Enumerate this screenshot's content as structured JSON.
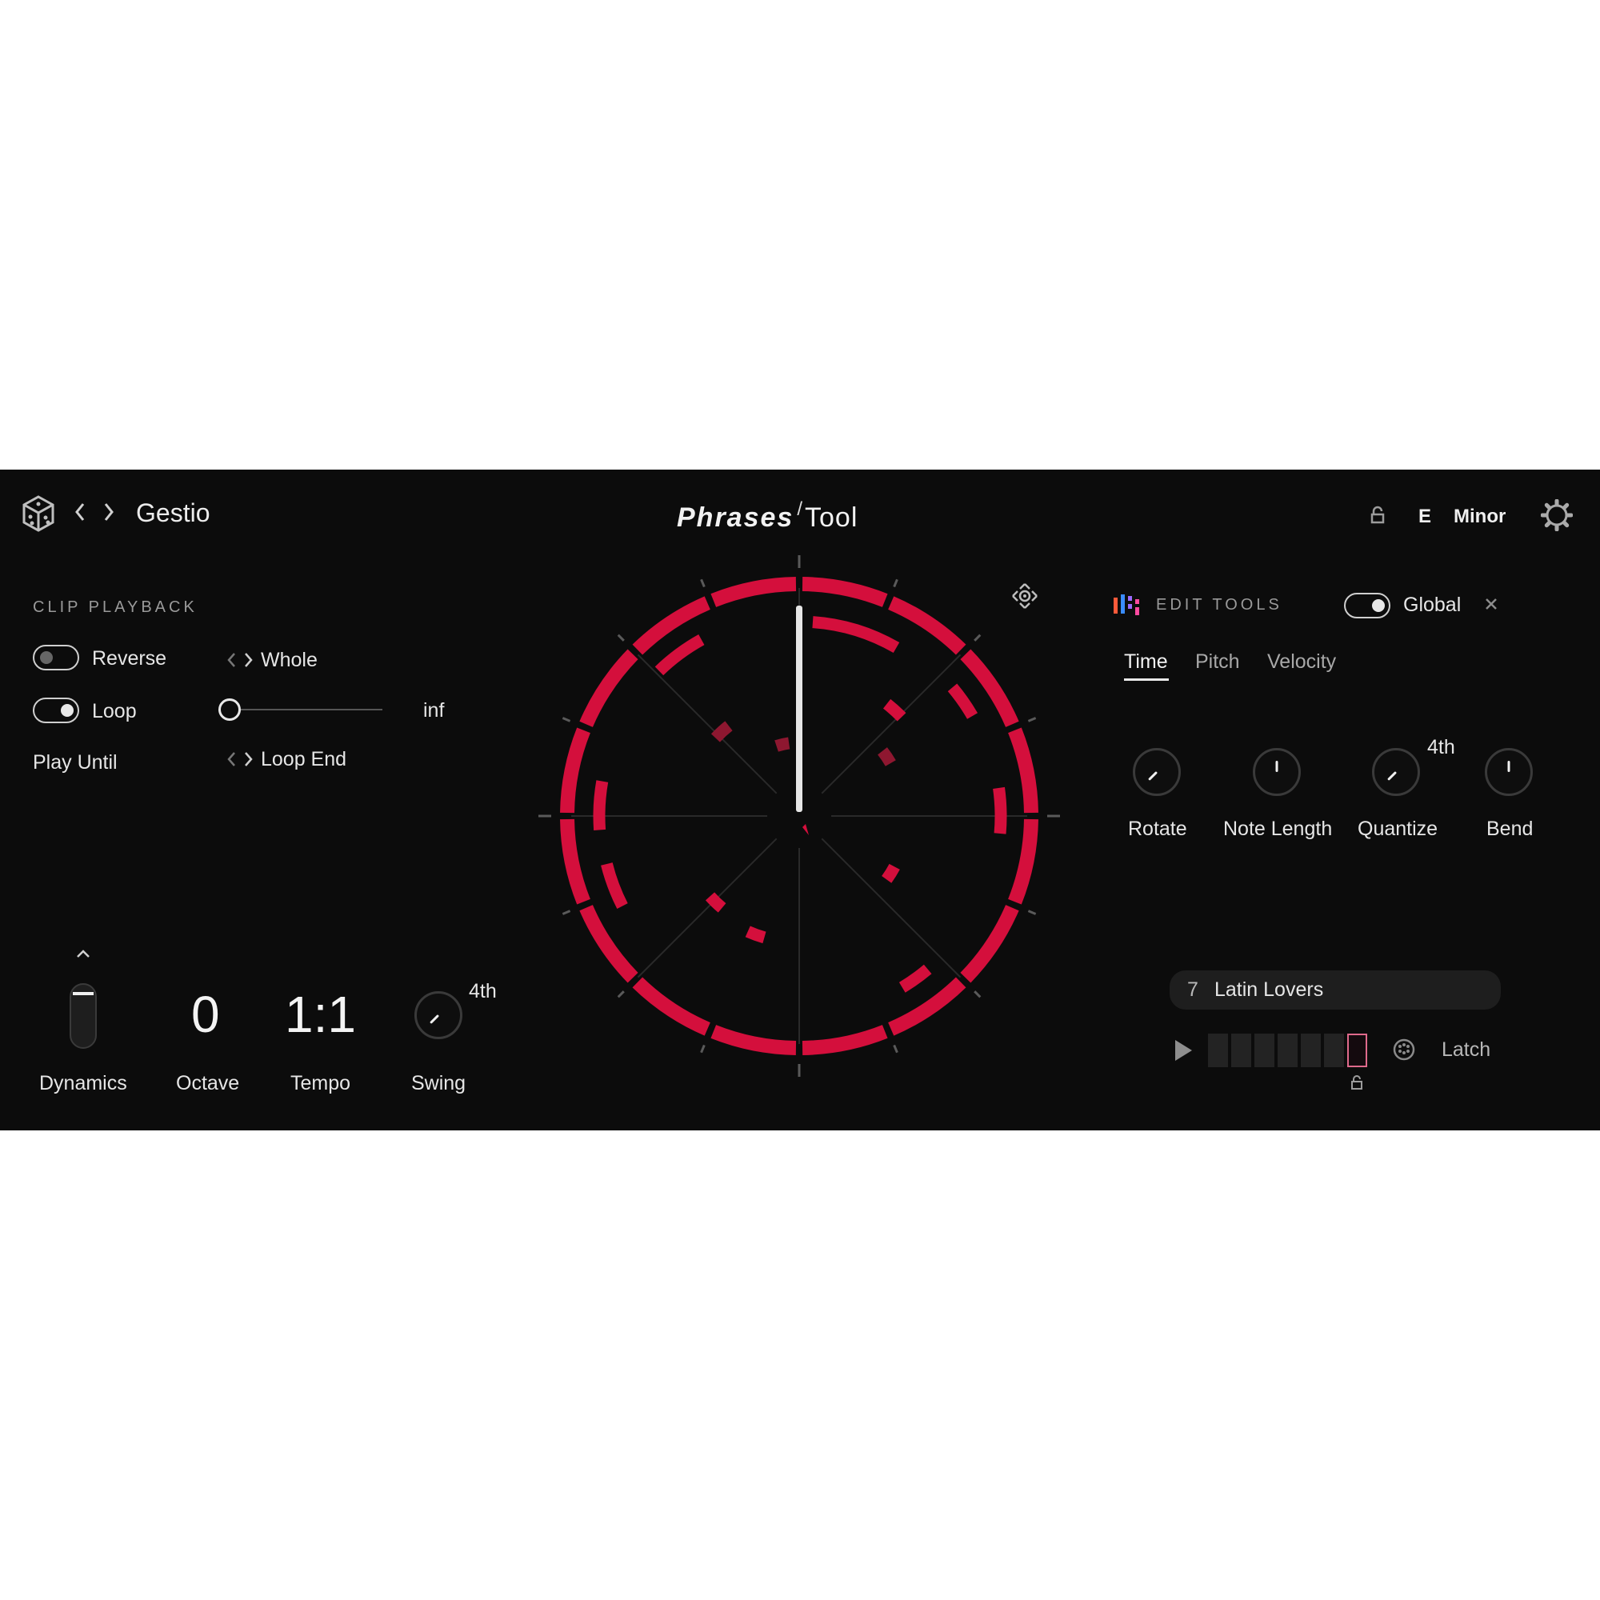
{
  "header": {
    "app_icon": "dice-icon",
    "prev_icon": "chevron-left-icon",
    "next_icon": "chevron-right-icon",
    "title": "Gestio",
    "brand_main": "Phrases",
    "brand_slash": "/",
    "brand_sub": "Tool",
    "lock_icon": "lock-icon",
    "key_root": "E",
    "key_scale": "Minor",
    "settings_icon": "gear-icon"
  },
  "clip_playback": {
    "section_label": "CLIP PLAYBACK",
    "reverse_label": "Reverse",
    "reverse_on": false,
    "loop_label": "Loop",
    "loop_on": true,
    "length_value": "Whole",
    "loop_slider_value": "inf",
    "play_until_label": "Play Until",
    "play_until_value": "Loop End"
  },
  "bottom_controls": {
    "dynamics_label": "Dynamics",
    "octave_value": "0",
    "octave_label": "Octave",
    "tempo_value": "1:1",
    "tempo_label": "Tempo",
    "swing_value": "4th",
    "swing_label": "Swing"
  },
  "edit_tools": {
    "section_label": "EDIT TOOLS",
    "global_label": "Global",
    "global_on": true,
    "close_icon": "close-icon",
    "tabs": [
      {
        "label": "Time",
        "active": true
      },
      {
        "label": "Pitch",
        "active": false
      },
      {
        "label": "Velocity",
        "active": false
      }
    ],
    "knobs": [
      {
        "label": "Rotate",
        "value": ""
      },
      {
        "label": "Note Length",
        "value": ""
      },
      {
        "label": "Quantize",
        "value": "4th"
      },
      {
        "label": "Bend",
        "value": ""
      }
    ]
  },
  "preset": {
    "number": "7",
    "name": "Latin Lovers",
    "play_icon": "play-icon",
    "step_count": 7,
    "current_step": 7,
    "pattern_icon": "pattern-icon",
    "latch_label": "Latch"
  },
  "colors": {
    "background": "#0c0c0c",
    "accent_red": "#d40f3c",
    "accent_dim": "#8e1730",
    "text": "#e9e9e9",
    "step_highlight": "#e06a8c"
  }
}
